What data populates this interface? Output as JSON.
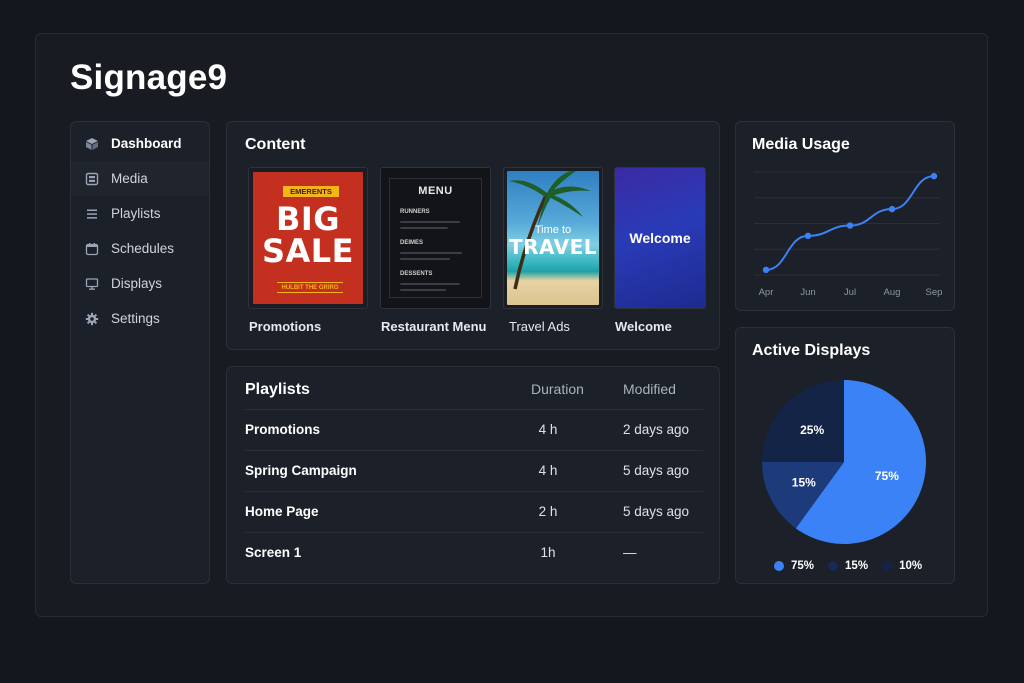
{
  "app": {
    "title": "Signage9"
  },
  "sidebar": {
    "items": [
      {
        "label": "Dashboard",
        "icon": "cube-icon"
      },
      {
        "label": "Media",
        "icon": "media-icon"
      },
      {
        "label": "Playlists",
        "icon": "list-icon"
      },
      {
        "label": "Schedules",
        "icon": "calendar-icon"
      },
      {
        "label": "Displays",
        "icon": "monitor-icon"
      },
      {
        "label": "Settings",
        "icon": "gear-icon"
      }
    ]
  },
  "content": {
    "title": "Content",
    "cards": [
      {
        "label": "Promotions",
        "thumb": {
          "tag": "EMERENTS",
          "line1": "BIG",
          "line2": "SALE",
          "strip": "HULBIT THE GRIRG"
        }
      },
      {
        "label": "Restaurant Menu",
        "thumb": {
          "title": "MENU",
          "sections": [
            "RUNNERS",
            "DEIMES",
            "DESSENTS"
          ]
        }
      },
      {
        "label": "Travel Ads",
        "thumb": {
          "small": "Time to",
          "big": "TRAVEL"
        }
      },
      {
        "label": "Welcome",
        "thumb": {
          "text": "Welcome"
        }
      }
    ]
  },
  "playlists": {
    "title": "Playlists",
    "columns": {
      "duration": "Duration",
      "modified": "Modified"
    },
    "rows": [
      {
        "name": "Promotions",
        "duration": "4 h",
        "modified": "2 days ago"
      },
      {
        "name": "Spring Campaign",
        "duration": "4 h",
        "modified": "5 days ago"
      },
      {
        "name": "Home Page",
        "duration": "2 h",
        "modified": "5 days ago"
      },
      {
        "name": "Screen 1",
        "duration": "1h",
        "modified": "—"
      }
    ]
  },
  "media_usage": {
    "title": "Media Usage",
    "chart_data": {
      "type": "line",
      "categories": [
        "Apr",
        "Jun",
        "Jul",
        "Aug",
        "Sep"
      ],
      "values": [
        5,
        38,
        48,
        64,
        96
      ],
      "ylim": [
        0,
        100
      ],
      "grid": true,
      "color": "#3b82f6"
    }
  },
  "active_displays": {
    "title": "Active Displays",
    "chart_data": {
      "type": "pie",
      "slices": [
        {
          "value": 60,
          "label": "75%",
          "color": "#3b82f6"
        },
        {
          "value": 15,
          "label": "15%",
          "color": "#1d3a7a"
        },
        {
          "value": 25,
          "label": "25%",
          "color": "#142447"
        }
      ],
      "legend": [
        {
          "label": "75%",
          "color": "#3b82f6"
        },
        {
          "label": "15%",
          "color": "#172a55"
        },
        {
          "label": "10%",
          "color": "#142447"
        }
      ]
    }
  },
  "colors": {
    "accent": "#3b82f6",
    "background": "#14171d",
    "panel": "#1c2028"
  }
}
